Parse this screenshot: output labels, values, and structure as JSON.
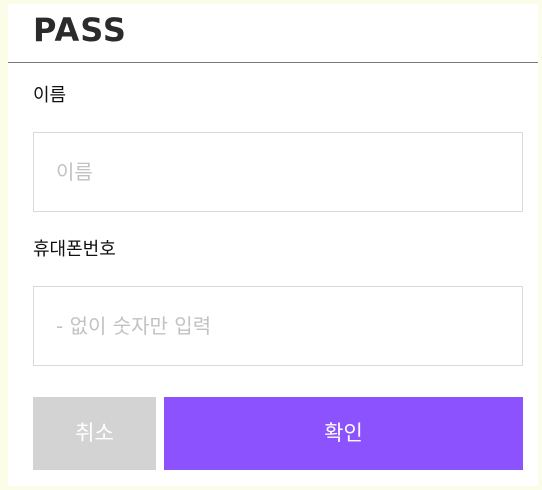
{
  "header": {
    "logo_text": "PASS"
  },
  "form": {
    "name_label": "이름",
    "name_placeholder": "이름",
    "phone_label": "휴대폰번호",
    "phone_placeholder": "- 없이 숫자만 입력"
  },
  "buttons": {
    "cancel_label": "취소",
    "confirm_label": "확인"
  },
  "colors": {
    "page_background": "#fbfde9",
    "confirm_button": "#8b52fd",
    "cancel_button": "#d3d3d3",
    "input_border": "#d9d9d9"
  }
}
